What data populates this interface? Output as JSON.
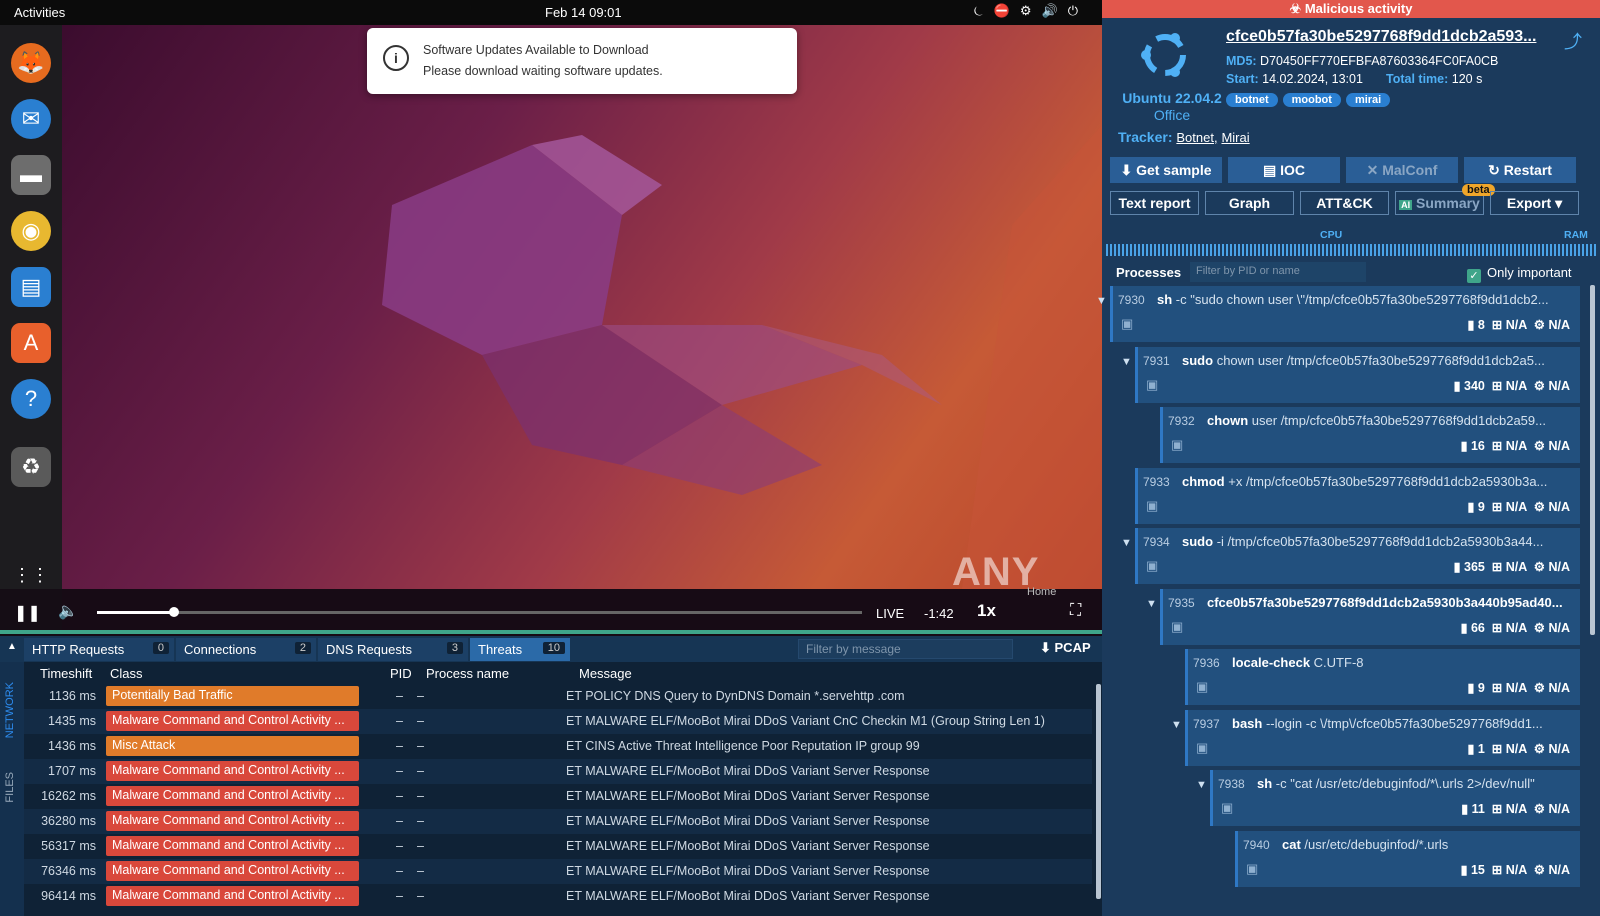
{
  "topbar": {
    "activities": "Activities",
    "clock": "Feb 14  09:01",
    "icons": [
      "bell-icon",
      "stop-icon",
      "network-icon",
      "volume-icon",
      "power-icon"
    ]
  },
  "notification": {
    "title": "Software Updates Available to Download",
    "body": "Please download waiting software updates."
  },
  "player": {
    "live": "LIVE",
    "remaining": "-1:42",
    "speed": "1x",
    "progress": 0.1,
    "home": "Home"
  },
  "watermark": "ANY RUN",
  "bottom": {
    "tabs": [
      {
        "label": "HTTP Requests",
        "count": "0"
      },
      {
        "label": "Connections",
        "count": "2"
      },
      {
        "label": "DNS Requests",
        "count": "3"
      },
      {
        "label": "Threats",
        "count": "10"
      }
    ],
    "filter_placeholder": "Filter by message",
    "pcap": "PCAP",
    "side_tabs": [
      "NETWORK",
      "FILES"
    ],
    "columns": [
      "Timeshift",
      "Class",
      "PID",
      "Process name",
      "Message"
    ],
    "rows": [
      {
        "time": "1136 ms",
        "class": "Potentially Bad Traffic",
        "color": "#e07b2a",
        "pid": "–",
        "proc": "–",
        "msg": "ET POLICY DNS Query to DynDNS Domain *.servehttp .com"
      },
      {
        "time": "1435 ms",
        "class": "Malware Command and Control Activity ...",
        "color": "#d9483b",
        "pid": "–",
        "proc": "–",
        "msg": "ET MALWARE ELF/MooBot Mirai DDoS Variant CnC Checkin M1 (Group String Len 1)"
      },
      {
        "time": "1436 ms",
        "class": "Misc Attack",
        "color": "#e07b2a",
        "pid": "–",
        "proc": "–",
        "msg": "ET CINS Active Threat Intelligence Poor Reputation IP group 99"
      },
      {
        "time": "1707 ms",
        "class": "Malware Command and Control Activity ...",
        "color": "#d9483b",
        "pid": "–",
        "proc": "–",
        "msg": "ET MALWARE ELF/MooBot Mirai DDoS Variant Server Response"
      },
      {
        "time": "16262 ms",
        "class": "Malware Command and Control Activity ...",
        "color": "#d9483b",
        "pid": "–",
        "proc": "–",
        "msg": "ET MALWARE ELF/MooBot Mirai DDoS Variant Server Response"
      },
      {
        "time": "36280 ms",
        "class": "Malware Command and Control Activity ...",
        "color": "#d9483b",
        "pid": "–",
        "proc": "–",
        "msg": "ET MALWARE ELF/MooBot Mirai DDoS Variant Server Response"
      },
      {
        "time": "56317 ms",
        "class": "Malware Command and Control Activity ...",
        "color": "#d9483b",
        "pid": "–",
        "proc": "–",
        "msg": "ET MALWARE ELF/MooBot Mirai DDoS Variant Server Response"
      },
      {
        "time": "76346 ms",
        "class": "Malware Command and Control Activity ...",
        "color": "#d9483b",
        "pid": "–",
        "proc": "–",
        "msg": "ET MALWARE ELF/MooBot Mirai DDoS Variant Server Response"
      },
      {
        "time": "96414 ms",
        "class": "Malware Command and Control Activity ...",
        "color": "#d9483b",
        "pid": "–",
        "proc": "–",
        "msg": "ET MALWARE ELF/MooBot Mirai DDoS Variant Server Response"
      }
    ]
  },
  "right": {
    "banner": "Malicious activity",
    "os_name": "Ubuntu 22.04.2",
    "os_edition": "Office",
    "hash": "cfce0b57fa30be5297768f9dd1dcb2a593...",
    "md5_label": "MD5:",
    "md5": "D70450FF770EFBFA87603364FC0FA0CB",
    "start_label": "Start:",
    "start": "14.02.2024, 13:01",
    "total_label": "Total time:",
    "total": "120 s",
    "tags": [
      "botnet",
      "moobot",
      "mirai"
    ],
    "tracker_label": "Tracker:",
    "trackers": [
      "Botnet,",
      "Mirai"
    ],
    "actions": [
      "Get sample",
      "IOC",
      "MalConf",
      "Restart"
    ],
    "options": [
      "Text report",
      "Graph",
      "ATT&CK",
      "Summary",
      "Export"
    ],
    "beta": "beta",
    "cpu": "CPU",
    "ram": "RAM",
    "processes_title": "Processes",
    "proc_filter": "Filter by PID or name",
    "only_important": "Only important",
    "processes": [
      {
        "pid": "7930",
        "name": "sh",
        "args": "-c \"sudo chown user \\\"/tmp/cfce0b57fa30be5297768f9dd1dcb2...",
        "files": "8",
        "a": "N/A",
        "b": "N/A"
      },
      {
        "pid": "7931",
        "name": "sudo",
        "args": "chown user /tmp/cfce0b57fa30be5297768f9dd1dcb2a5...",
        "files": "340",
        "a": "N/A",
        "b": "N/A"
      },
      {
        "pid": "7932",
        "name": "chown",
        "args": "user /tmp/cfce0b57fa30be5297768f9dd1dcb2a59...",
        "files": "16",
        "a": "N/A",
        "b": "N/A"
      },
      {
        "pid": "7933",
        "name": "chmod",
        "args": "+x /tmp/cfce0b57fa30be5297768f9dd1dcb2a5930b3a...",
        "files": "9",
        "a": "N/A",
        "b": "N/A"
      },
      {
        "pid": "7934",
        "name": "sudo",
        "args": "-i /tmp/cfce0b57fa30be5297768f9dd1dcb2a5930b3a44...",
        "files": "365",
        "a": "N/A",
        "b": "N/A"
      },
      {
        "pid": "7935",
        "name": "cfce0b57fa30be5297768f9dd1dcb2a5930b3a440b95ad40...",
        "args": "",
        "files": "66",
        "a": "N/A",
        "b": "N/A"
      },
      {
        "pid": "7936",
        "name": "locale-check",
        "args": "C.UTF-8",
        "files": "9",
        "a": "N/A",
        "b": "N/A"
      },
      {
        "pid": "7937",
        "name": "bash",
        "args": "--login -c \\/tmp\\/cfce0b57fa30be5297768f9dd1...",
        "files": "1",
        "a": "N/A",
        "b": "N/A"
      },
      {
        "pid": "7938",
        "name": "sh",
        "args": "-c \"cat /usr/etc/debuginfod/*\\.urls 2>/dev/null\"",
        "files": "11",
        "a": "N/A",
        "b": "N/A"
      },
      {
        "pid": "7940",
        "name": "cat",
        "args": "/usr/etc/debuginfod/*.urls",
        "files": "15",
        "a": "N/A",
        "b": "N/A"
      }
    ]
  }
}
